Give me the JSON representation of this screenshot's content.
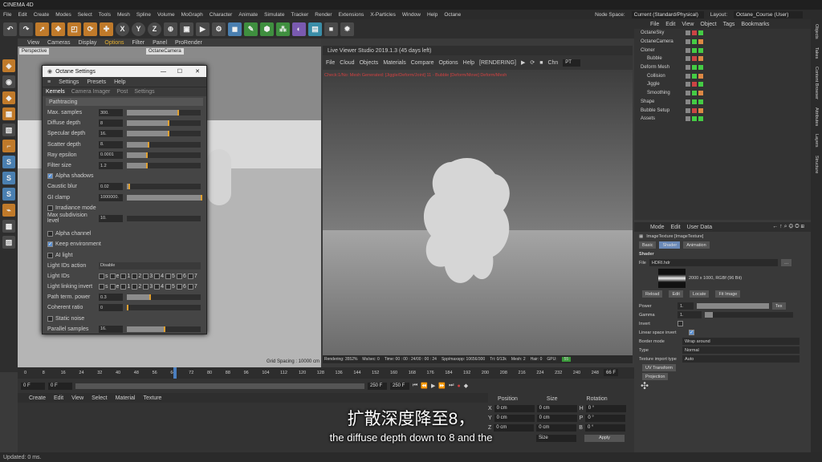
{
  "app_title": "CINEMA 4D",
  "menu": [
    "File",
    "Edit",
    "Create",
    "Modes",
    "Select",
    "Tools",
    "Mesh",
    "Spline",
    "Volume",
    "MoGraph",
    "Character",
    "Animate",
    "Simulate",
    "Tracker",
    "Render",
    "Extensions",
    "X-Particles",
    "Window",
    "Help",
    "Octane"
  ],
  "node_space_label": "Node Space:",
  "node_space_value": "Current (Standard/Physical)",
  "layout_label": "Layout:",
  "layout_value": "Octane_Course (User)",
  "toolbar_xyz": [
    "X",
    "Y",
    "Z"
  ],
  "viewport1": {
    "menu": [
      "View",
      "Cameras",
      "Display",
      "Options",
      "Filter",
      "Panel",
      "ProRender"
    ],
    "label": "Perspective",
    "camera": "OctaneCamera",
    "grid": "Grid Spacing : 10000 cm"
  },
  "live_viewer": {
    "title": "Live Viewer Studio 2019.1.3 (45 days left)",
    "menu": [
      "File",
      "Cloud",
      "Objects",
      "Materials",
      "Compare",
      "Options",
      "Help",
      "[RENDERING]"
    ],
    "chn_label": "Chn",
    "chn_value": "PT",
    "warning": "Check:1/No: Mesh Generated: [Jiggle/Deform/Joint] 11 - Bubble [Deform/Move] Deform/Mesh",
    "status": [
      "Rendering: 3552%",
      "Ms/sec: 0",
      "Time: 00 : 00 : 24/00 : 00 : 24",
      "Spp/maxspp: 10656/300",
      "Tri: 0/13k",
      "Mesh: 2",
      "Hair: 0",
      "GPU:",
      "55"
    ]
  },
  "octane_settings": {
    "title": "Octane Settings",
    "menu": [
      "Settings",
      "Presets",
      "Help"
    ],
    "tabs": [
      "Kernels",
      "Camera Imager",
      "Post",
      "Settings"
    ],
    "section": "Pathtracing",
    "params": [
      {
        "label": "Max. samples",
        "value": "300.",
        "fill": 0.68
      },
      {
        "label": "Diffuse depth",
        "value": "8",
        "fill": 0.55
      },
      {
        "label": "Specular depth",
        "value": "16.",
        "fill": 0.55
      },
      {
        "label": "Scatter depth",
        "value": "8.",
        "fill": 0.28
      },
      {
        "label": "Ray epsilon",
        "value": "0.0001",
        "fill": 0.26
      },
      {
        "label": "Filter size",
        "value": "1.2",
        "fill": 0.26
      }
    ],
    "alpha_shadows": "Alpha shadows",
    "caustic_blur": {
      "label": "Caustic blur",
      "value": "0.02",
      "fill": 0.02
    },
    "gi_clamp": {
      "label": "GI clamp",
      "value": "1000000.",
      "fill": 1.0
    },
    "irradiance_mode": "Irradiance mode",
    "max_subdiv": {
      "label": "Max subdivision level",
      "value": "10."
    },
    "alpha_channel": "Alpha channel",
    "keep_environment": "Keep environment",
    "ai_light": "AI light",
    "light_ids_action": {
      "label": "Light IDs action",
      "value": "Disable"
    },
    "light_ids": "Light IDs",
    "light_linking_invert": "Light linking invert",
    "light_id_labels": [
      "s",
      "e",
      "1",
      "2",
      "3",
      "4",
      "5",
      "6",
      "7"
    ],
    "path_term_power": {
      "label": "Path term. power",
      "value": "0.3",
      "fill": 0.3
    },
    "coherent_ratio": {
      "label": "Coherent ratio",
      "value": "0",
      "fill": 0.0
    },
    "static_noise": "Static noise",
    "parallel_samples": {
      "label": "Parallel samples",
      "value": "16.",
      "fill": 0.5
    }
  },
  "object_manager": {
    "menu": [
      "File",
      "Edit",
      "View",
      "Object",
      "Tags",
      "Bookmarks"
    ],
    "objects": [
      "OctaneSky",
      "OctaneCamera",
      "Cloner",
      "Bubble",
      "Deform Mesh",
      "Collision",
      "Jiggle",
      "Smoothing",
      "Shape",
      "Bubble Setup",
      "Assets"
    ]
  },
  "side_tabs": [
    "Objects",
    "Takes",
    "Content Browser",
    "Attributes",
    "Layers",
    "Structure"
  ],
  "attributes": {
    "menu": [
      "Mode",
      "Edit",
      "User Data"
    ],
    "title": "ImageTexture [ImageTexture]",
    "tabs": [
      "Basic",
      "Shader",
      "Animation"
    ],
    "shader_label": "Shader",
    "file_label": "File",
    "file_value": "HDRI.hdr",
    "image_info": "2000 x 1000, RGBf (96 Bit)",
    "buttons": [
      "Reload",
      "Edit",
      "Locate",
      "Fit Image"
    ],
    "power_label": "Power",
    "power_value": "1.",
    "tex_btn": "Tex",
    "gamma_label": "Gamma",
    "gamma_value": "1.",
    "invert_label": "Invert",
    "linear_label": "Linear space invert",
    "border_label": "Border mode",
    "border_value": "Wrap around",
    "type_label": "Type",
    "type_value": "Normal",
    "import_label": "Texture import type",
    "import_value": "Auto",
    "uv_btn": "UV Transform",
    "proj_btn": "Projection"
  },
  "timeline": {
    "ticks": [
      "0",
      "8",
      "16",
      "24",
      "32",
      "40",
      "48",
      "56",
      "64",
      "72",
      "80",
      "88",
      "96",
      "104",
      "112",
      "120",
      "128",
      "136",
      "144",
      "152",
      "160",
      "168",
      "176",
      "184",
      "192",
      "200",
      "208",
      "216",
      "224",
      "232",
      "240",
      "248"
    ],
    "current": "66 F",
    "start": "0 F",
    "start2": "0 F",
    "end": "250 F",
    "end2": "250 F"
  },
  "material_menu": [
    "Create",
    "Edit",
    "View",
    "Select",
    "Material",
    "Texture"
  ],
  "coords": {
    "headers": [
      "Position",
      "Size",
      "Rotation"
    ],
    "rows": [
      [
        "X",
        "0 cm",
        "0 cm",
        "H",
        "0 °"
      ],
      [
        "Y",
        "0 cm",
        "0 cm",
        "P",
        "0 °"
      ],
      [
        "Z",
        "0 cm",
        "0 cm",
        "B",
        "0 °"
      ]
    ],
    "apply": "Apply",
    "size_label": "Size"
  },
  "subtitle_cn": "扩散深度降至8，",
  "subtitle_en": "the diffuse depth down to 8 and the",
  "status": "Updated: 0 ms."
}
